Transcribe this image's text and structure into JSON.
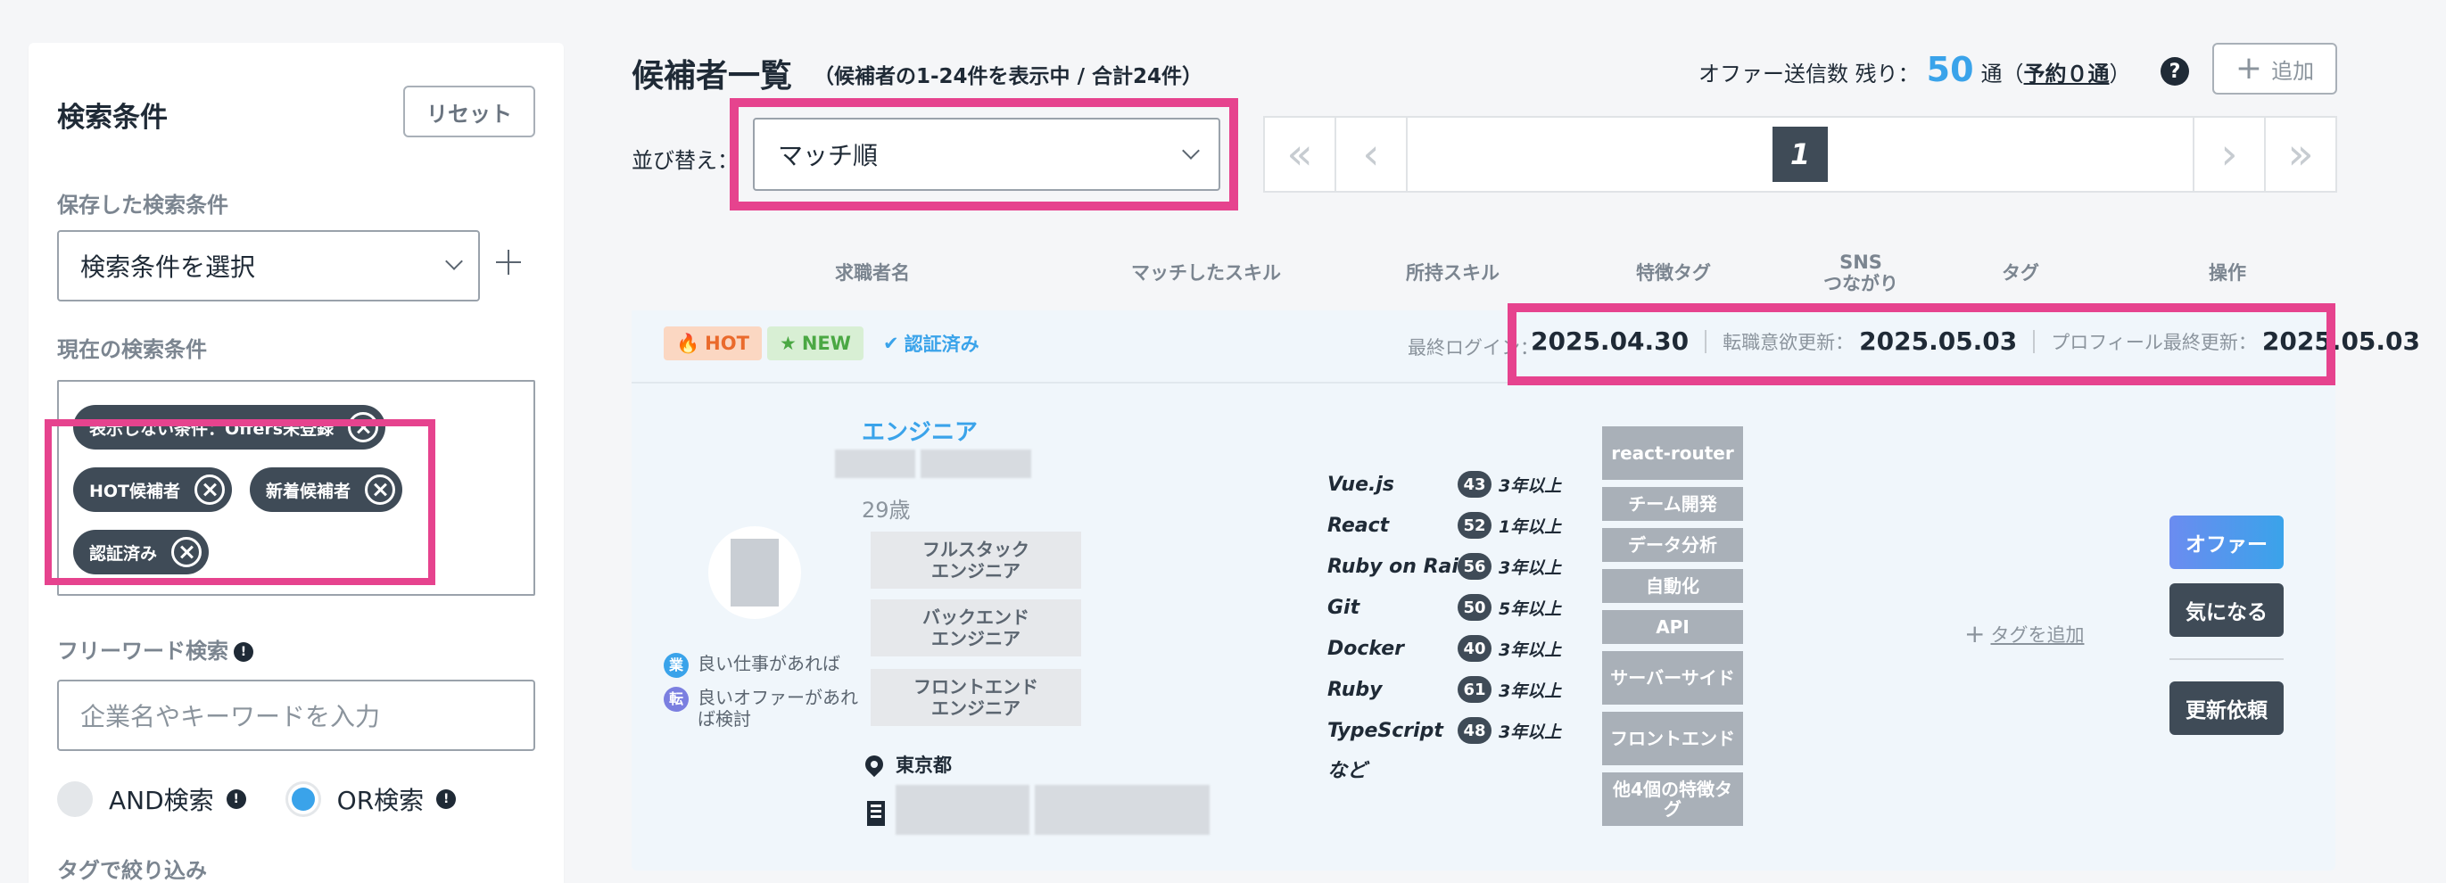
{
  "sidebar": {
    "title": "検索条件",
    "reset_label": "リセット",
    "saved_label": "保存した検索条件",
    "saved_select_value": "検索条件を選択",
    "current_label": "現在の検索条件",
    "chips": [
      "表示しない条件：Offers未登録",
      "HOT候補者",
      "新着候補者",
      "認証済み"
    ],
    "freeword_label": "フリーワード検索",
    "freeword_placeholder": "企業名やキーワードを入力",
    "and_label": "AND検索",
    "or_label": "OR検索",
    "selected_mode": "OR検索",
    "tag_filter_label": "タグで絞り込み"
  },
  "header": {
    "title": "候補者一覧",
    "subtitle": "（候補者の1-24件を表示中 / 合計24件）",
    "offer_prefix": "オファー送信数 残り：",
    "offer_remaining": "50",
    "offer_unit": "通（",
    "reserve_text": "予約０通",
    "offer_suffix": "）",
    "add_label": "追加"
  },
  "sort": {
    "label": "並び替え：",
    "value": "マッチ順"
  },
  "pager": {
    "current_page": "1"
  },
  "columns": [
    "求職者名",
    "マッチしたスキル",
    "所持スキル",
    "特徴タグ",
    "SNS",
    "つながり",
    "タグ",
    "操作"
  ],
  "candidate": {
    "badges": {
      "hot": "HOT",
      "new": "NEW",
      "verified": "認証済み"
    },
    "last_login_label": "最終ログイン：",
    "last_login": "2025.04.30",
    "intent_label": "転職意欲更新：",
    "intent_date": "2025.05.03",
    "profile_label": "プロフィール最終更新：",
    "profile_date": "2025.05.03",
    "job_title": "エンジニア",
    "age": "29歳",
    "roles": [
      "フルスタック\nエンジニア",
      "バックエンド\nエンジニア",
      "フロントエンド\nエンジニア"
    ],
    "preferences": [
      {
        "icon": "業",
        "text": "良い仕事があれば",
        "color": "#3aa3ea"
      },
      {
        "icon": "転",
        "text": "良いオファーがあれば検討",
        "color": "#7b7fe0"
      }
    ],
    "location": "東京都",
    "skills": [
      {
        "name": "Vue.js",
        "count": "43",
        "years": "3年以上"
      },
      {
        "name": "React",
        "count": "52",
        "years": "1年以上"
      },
      {
        "name": "Ruby on Rails",
        "count": "56",
        "years": "3年以上"
      },
      {
        "name": "Git",
        "count": "50",
        "years": "5年以上"
      },
      {
        "name": "Docker",
        "count": "40",
        "years": "3年以上"
      },
      {
        "name": "Ruby",
        "count": "61",
        "years": "3年以上"
      },
      {
        "name": "TypeScript",
        "count": "48",
        "years": "3年以上"
      }
    ],
    "skills_more": "など",
    "feature_tags": [
      "react-router",
      "チーム開発",
      "データ分析",
      "自動化",
      "API",
      "サーバーサイド",
      "フロントエンド",
      "他4個の特徴タグ"
    ],
    "add_tag_label": "タグを追加",
    "actions": {
      "offer": "オファー",
      "favorite": "気になる",
      "update_request": "更新依頼"
    }
  },
  "colors": {
    "highlight": "#e6438e",
    "accent": "#3aa3ea",
    "dark": "#3f4b57"
  }
}
